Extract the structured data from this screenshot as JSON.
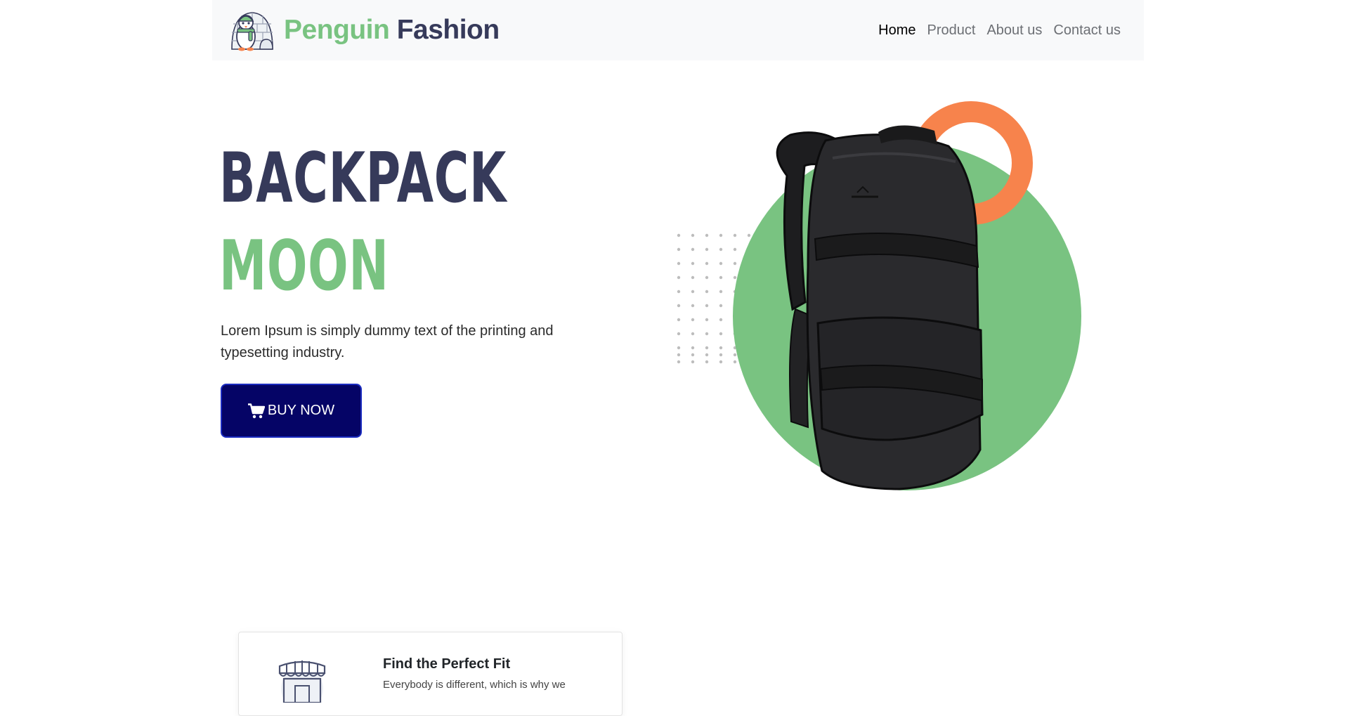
{
  "brand": {
    "word1": "Penguin",
    "word2": "Fashion",
    "logo_icon": "penguin-igloo-logo"
  },
  "nav": {
    "items": [
      {
        "label": "Home",
        "active": true
      },
      {
        "label": "Product",
        "active": false
      },
      {
        "label": "About us",
        "active": false
      },
      {
        "label": "Contact us",
        "active": false
      }
    ]
  },
  "hero": {
    "title_line1": "BACKPACK",
    "title_line2": "MOON",
    "description": "Lorem Ipsum is simply dummy text of the printing and typesetting industry.",
    "button_label": "BUY NOW",
    "button_icon": "shopping-cart-icon",
    "image": "black-backpack"
  },
  "feature_card": {
    "icon": "storefront-icon",
    "title": "Find the Perfect Fit",
    "text": "Everybody is different, which is why we"
  },
  "colors": {
    "navy": "#363a5a",
    "green": "#79c381",
    "orange": "#f7834c",
    "button": "#050466",
    "navbar_bg": "#f8f9fa"
  }
}
